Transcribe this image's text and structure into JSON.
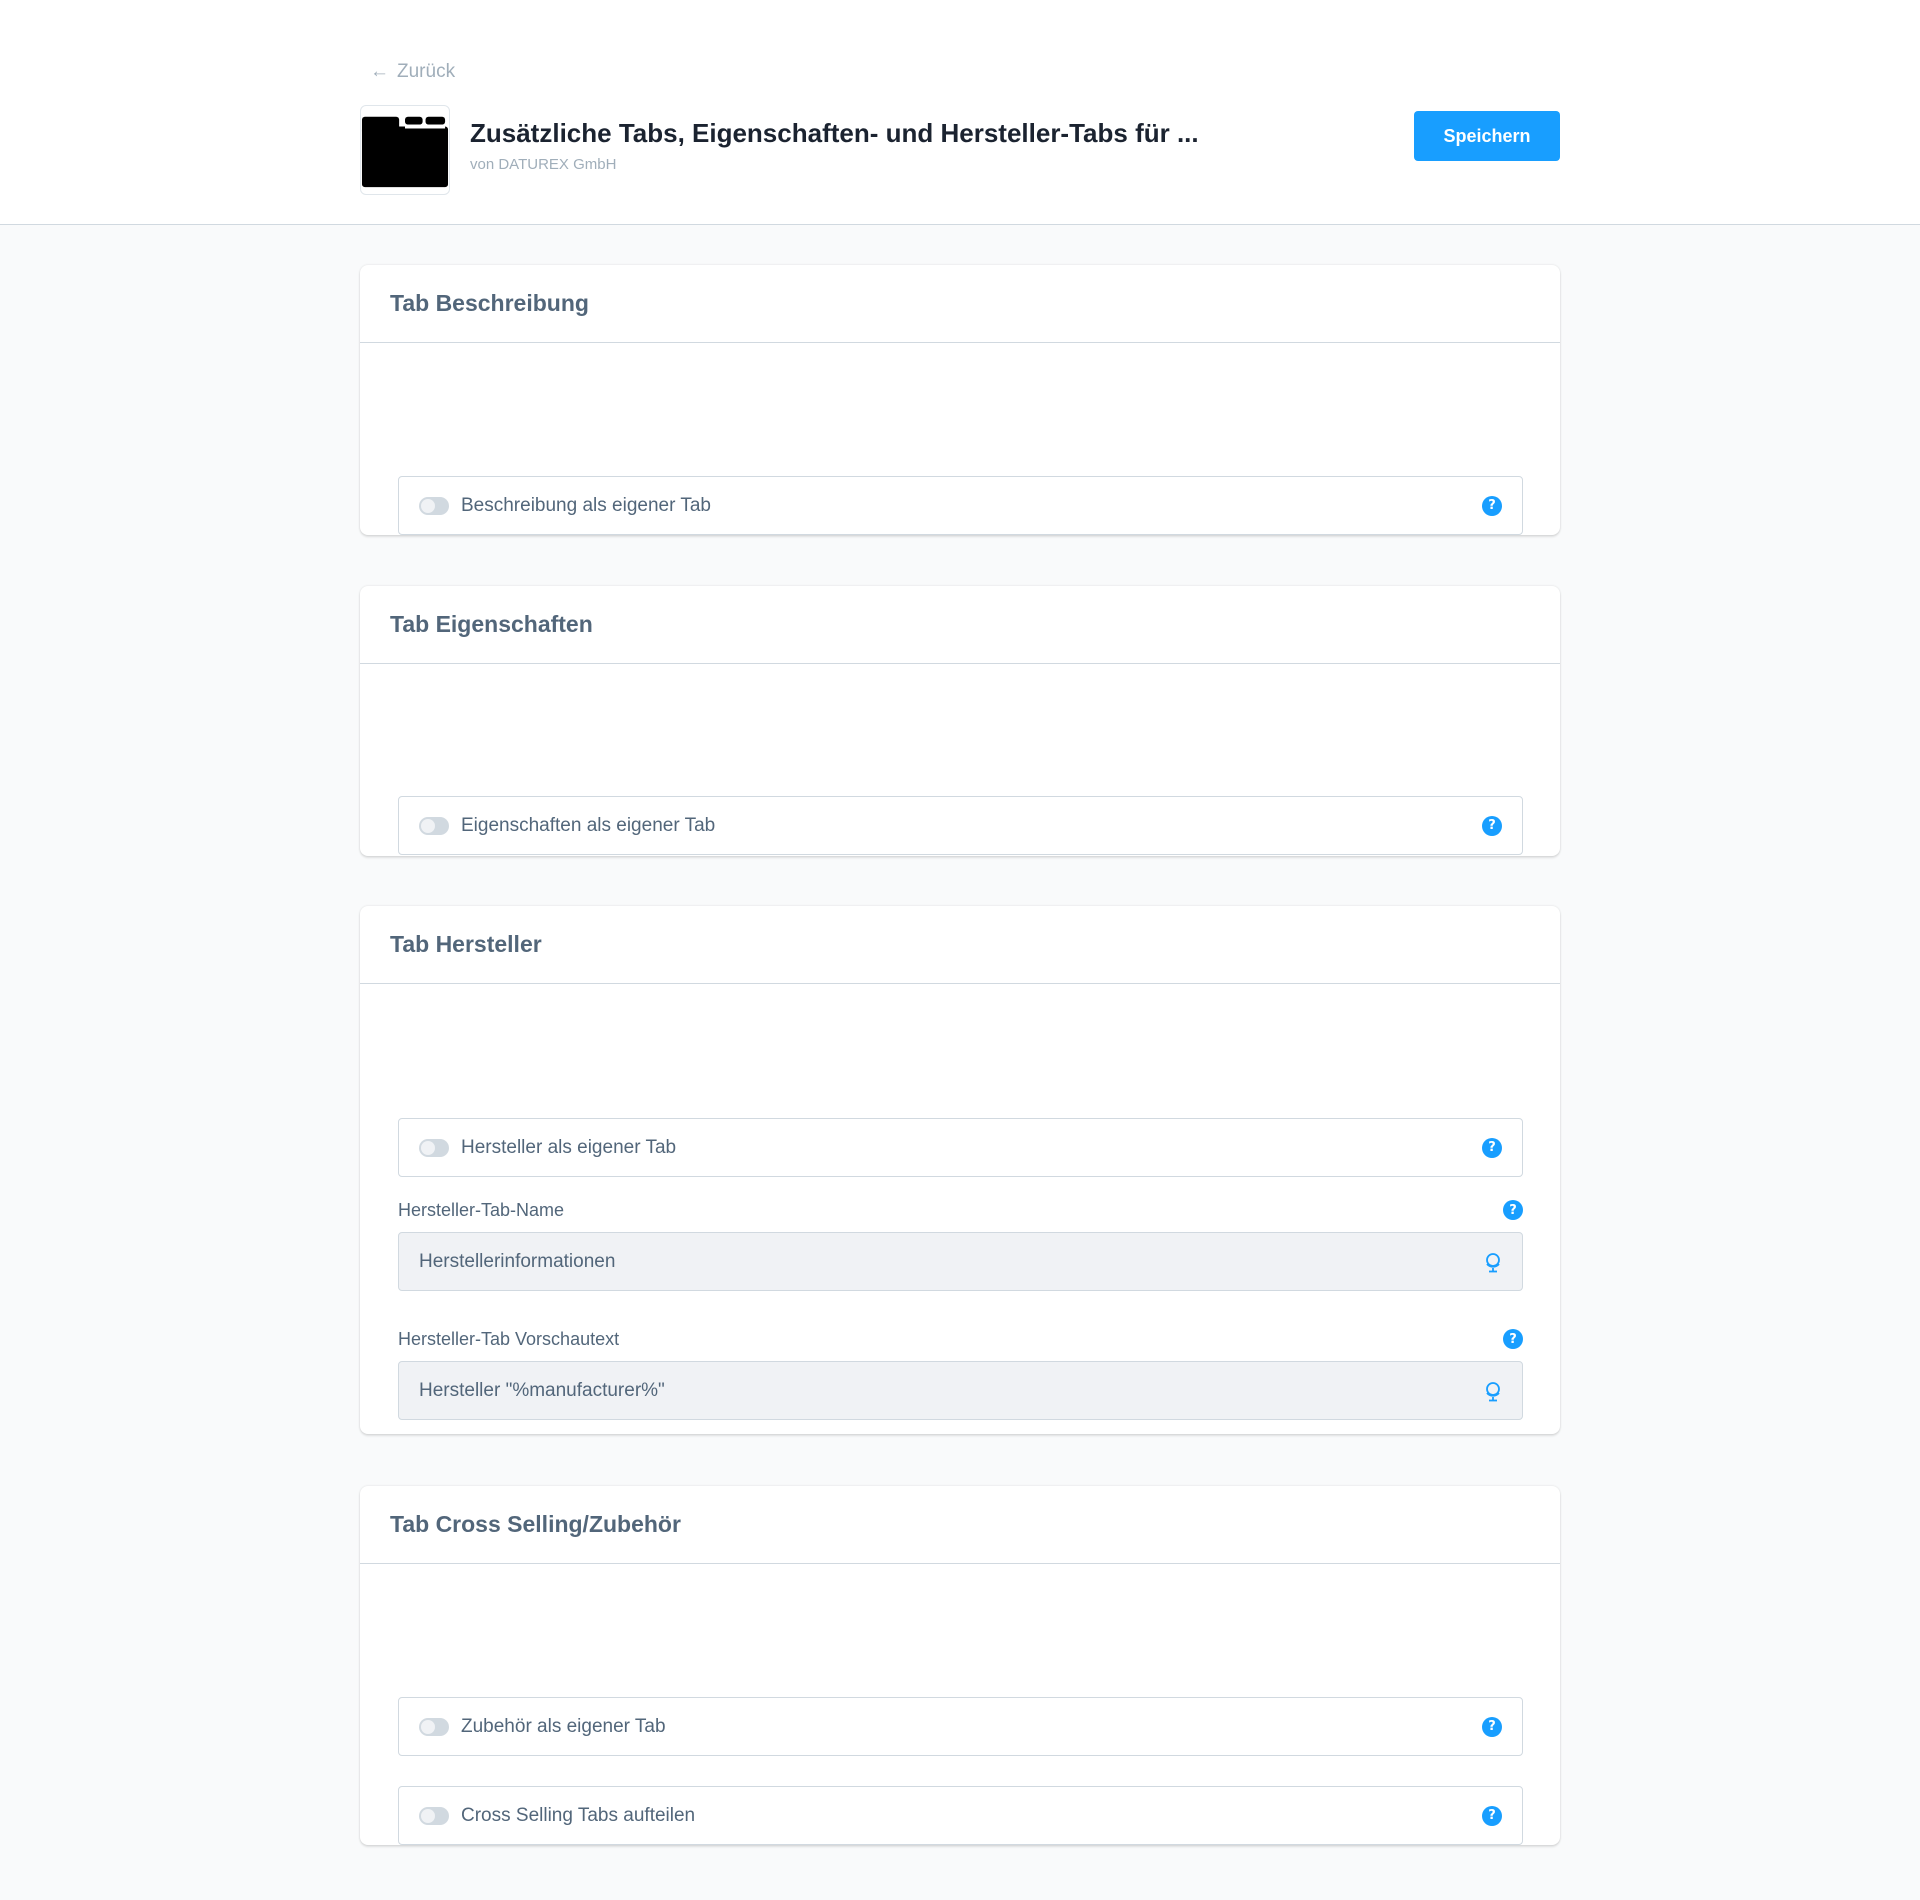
{
  "header": {
    "back_label": "Zurück",
    "title": "Zusätzliche Tabs, Eigenschaften- und Hersteller-Tabs für ...",
    "vendor": "von DATUREX GmbH",
    "save_label": "Speichern",
    "app_icon": "folder-icon"
  },
  "colors": {
    "accent": "#189eff",
    "text": "#52667a",
    "title": "#1b2330",
    "muted": "#a0aeba",
    "border": "#d1d9e0",
    "background": "#f9fafb"
  },
  "sections": [
    {
      "title": "Tab Beschreibung",
      "switches": [
        {
          "label": "Beschreibung als eigener Tab",
          "enabled": false
        }
      ]
    },
    {
      "title": "Tab Eigenschaften",
      "switches": [
        {
          "label": "Eigenschaften als eigener Tab",
          "enabled": false
        }
      ]
    },
    {
      "title": "Tab Hersteller",
      "switches": [
        {
          "label": "Hersteller als eigener Tab",
          "enabled": false
        }
      ],
      "fields": [
        {
          "label": "Hersteller-Tab-Name",
          "value": "Herstellerinformationen"
        },
        {
          "label": "Hersteller-Tab Vorschautext",
          "value": "Hersteller \"%manufacturer%\""
        }
      ]
    },
    {
      "title": "Tab Cross Selling/Zubehör",
      "switches": [
        {
          "label": "Zubehör als eigener Tab",
          "enabled": false
        },
        {
          "label": "Cross Selling Tabs aufteilen",
          "enabled": false
        }
      ]
    }
  ],
  "icons": {
    "help": "help-icon",
    "translation": "globe-icon",
    "back": "arrow-left-icon"
  }
}
